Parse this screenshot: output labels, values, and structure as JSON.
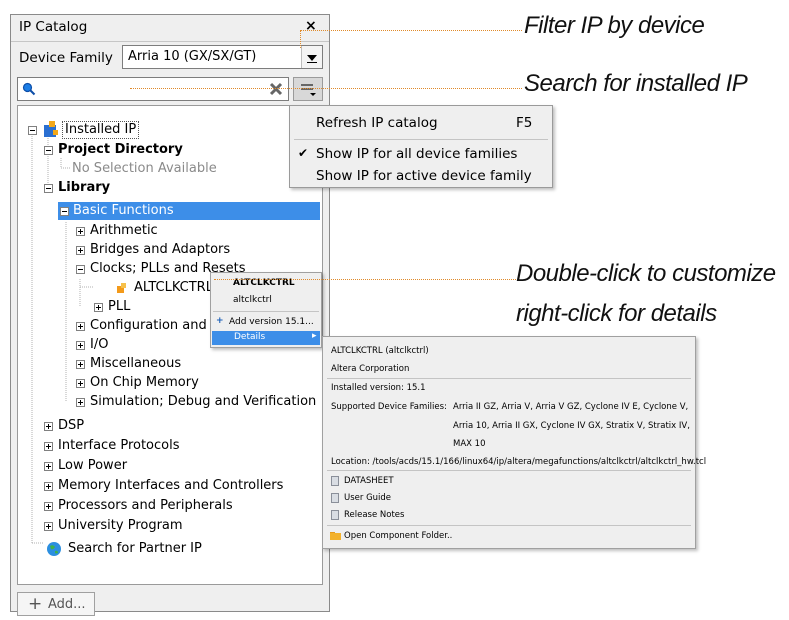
{
  "catalog": {
    "title": "IP Catalog",
    "close": "×",
    "device_family_label": "Device Family",
    "device_family_value": "Arria 10 (GX/SX/GT)",
    "add_button": "Add...",
    "add_icon": "+"
  },
  "filter_menu": {
    "refresh": "Refresh IP catalog",
    "refresh_shortcut": "F5",
    "check": "✔",
    "all_families": "Show IP for all device families",
    "active_family": "Show IP for active device family"
  },
  "tree": {
    "installed_ip": "Installed IP",
    "project_directory": "Project Directory",
    "no_selection": "No Selection Available",
    "library": "Library",
    "basic_functions": "Basic Functions",
    "arithmetic": "Arithmetic",
    "bridges": "Bridges and Adaptors",
    "clocks": "Clocks; PLLs and Resets",
    "altclkctrl": "ALTCLKCTRL",
    "pll": "PLL",
    "configuration": "Configuration and Pr",
    "io": "I/O",
    "misc": "Miscellaneous",
    "on_chip_memory": "On Chip Memory",
    "simulation": "Simulation; Debug and Verification",
    "dsp": "DSP",
    "interface_protocols": "Interface Protocols",
    "low_power": "Low Power",
    "memory_interfaces": "Memory Interfaces and Controllers",
    "processors": "Processors and Peripherals",
    "university": "University Program",
    "partner_ip": "Search for Partner IP"
  },
  "context_menu": {
    "title": "ALTCLKCTRL",
    "subtitle": "altclkctrl",
    "add_version": "Add version 15.1...",
    "details": "Details"
  },
  "details": {
    "name": "ALTCLKCTRL (altclkctrl)",
    "vendor": "Altera Corporation",
    "installed_version": "Installed version: 15.1",
    "supported_label": "Supported Device Families:",
    "families_line1": "Arria II GZ, Arria V, Arria V GZ, Cyclone IV E, Cyclone V,",
    "families_line2": "Arria 10, Arria II GX, Cyclone IV GX, Stratix V, Stratix IV,",
    "families_line3": "MAX 10",
    "location": "Location: /tools/acds/15.1/166/linux64/ip/altera/megafunctions/altclkctrl/altclkctrl_hw.tcl",
    "datasheet": "DATASHEET",
    "user_guide": "User Guide",
    "release_notes": "Release Notes",
    "open_folder": "Open Component Folder.."
  },
  "annotations": {
    "filter": "Filter IP by device",
    "search": "Search for installed IP",
    "double_click": "Double-click to customize",
    "right_click": "right-click for details"
  },
  "colors": {
    "selection": "#3d8ee8",
    "annotation_line": "#e08a2a",
    "panel_bg": "#efefef"
  }
}
